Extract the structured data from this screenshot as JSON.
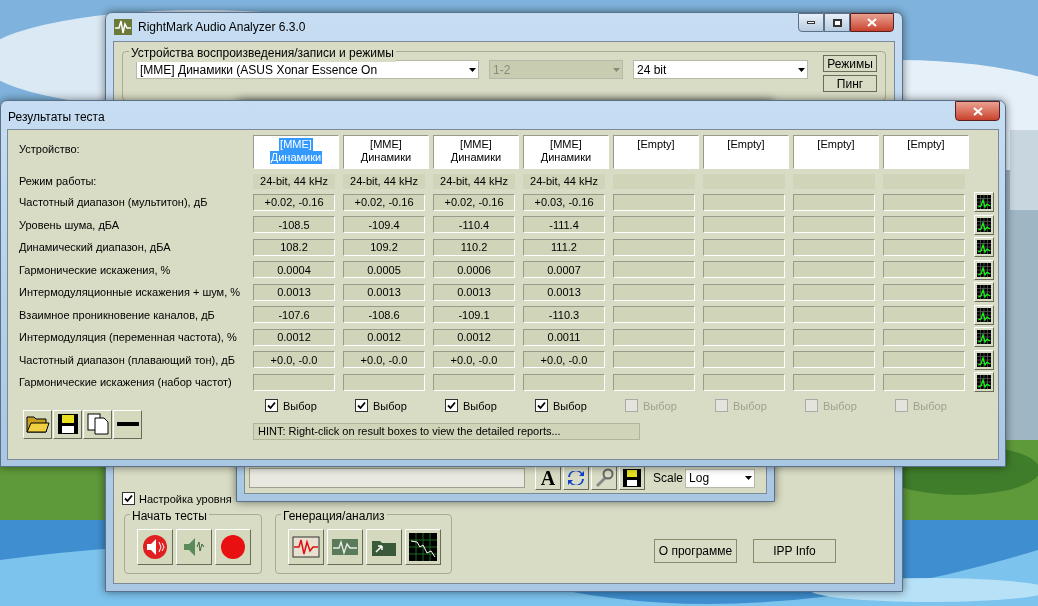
{
  "main_window": {
    "title": "RightMark Audio Analyzer 6.3.0",
    "devices_group": {
      "title": "Устройства воспроизведения/записи и режимы",
      "device": "[MME] Динамики (ASUS Xonar Essence On",
      "channels": "1-2",
      "channels_disabled": true,
      "format": "24 bit"
    },
    "side_buttons": [
      "Режимы",
      "Пинг"
    ],
    "level_checkbox": {
      "label": "Настройка уровня",
      "checked": true
    },
    "start_tests": {
      "title": "Начать тесты"
    },
    "generation": {
      "title": "Генерация/анализ"
    },
    "buttons": [
      "О программе",
      "IPP Info"
    ]
  },
  "phase_window": {
    "font_button": "A",
    "scale_label": "Scale",
    "scale_value": "Log"
  },
  "results_window": {
    "title": "Результаты теста",
    "device_label": "Устройство:",
    "mode_label": "Режим работы:",
    "columns": [
      {
        "device_lines": [
          "[MME]",
          "Динамики"
        ],
        "selected": true,
        "mode": "24-bit, 44 kHz",
        "pick": {
          "label": "Выбор",
          "checked": true,
          "enabled": true
        }
      },
      {
        "device_lines": [
          "[MME]",
          "Динамики"
        ],
        "selected": false,
        "mode": "24-bit, 44 kHz",
        "pick": {
          "label": "Выбор",
          "checked": true,
          "enabled": true
        }
      },
      {
        "device_lines": [
          "[MME]",
          "Динамики"
        ],
        "selected": false,
        "mode": "24-bit, 44 kHz",
        "pick": {
          "label": "Выбор",
          "checked": true,
          "enabled": true
        }
      },
      {
        "device_lines": [
          "[MME]",
          "Динамики"
        ],
        "selected": false,
        "mode": "24-bit, 44 kHz",
        "pick": {
          "label": "Выбор",
          "checked": true,
          "enabled": true
        }
      },
      {
        "device_lines": [
          "[Empty]"
        ],
        "selected": false,
        "pick": {
          "label": "Выбор",
          "checked": false,
          "enabled": false
        }
      },
      {
        "device_lines": [
          "[Empty]"
        ],
        "selected": false,
        "pick": {
          "label": "Выбор",
          "checked": false,
          "enabled": false
        }
      },
      {
        "device_lines": [
          "[Empty]"
        ],
        "selected": false,
        "pick": {
          "label": "Выбор",
          "checked": false,
          "enabled": false
        }
      },
      {
        "device_lines": [
          "[Empty]"
        ],
        "selected": false,
        "pick": {
          "label": "Выбор",
          "checked": false,
          "enabled": false
        }
      }
    ],
    "rows": [
      {
        "label": "Частотный диапазон (мультитон), дБ",
        "values": [
          "+0.02, -0.16",
          "+0.02, -0.16",
          "+0.02, -0.16",
          "+0.03, -0.16"
        ]
      },
      {
        "label": "Уровень шума, дБА",
        "values": [
          "-108.5",
          "-109.4",
          "-110.4",
          "-111.4"
        ]
      },
      {
        "label": "Динамический диапазон, дБА",
        "values": [
          "108.2",
          "109.2",
          "110.2",
          "111.2"
        ]
      },
      {
        "label": "Гармонические искажения, %",
        "values": [
          "0.0004",
          "0.0005",
          "0.0006",
          "0.0007"
        ]
      },
      {
        "label": "Интермодуляционные искажения + шум, %",
        "values": [
          "0.0013",
          "0.0013",
          "0.0013",
          "0.0013"
        ]
      },
      {
        "label": "Взаимное проникновение каналов, дБ",
        "values": [
          "-107.6",
          "-108.6",
          "-109.1",
          "-110.3"
        ]
      },
      {
        "label": "Интермодуляция (переменная частота), %",
        "values": [
          "0.0012",
          "0.0012",
          "0.0012",
          "0.0011"
        ]
      },
      {
        "label": "Частотный диапазон (плавающий тон), дБ",
        "values": [
          "+0.0, -0.0",
          "+0.0, -0.0",
          "+0.0, -0.0",
          "+0.0, -0.0"
        ]
      },
      {
        "label": "Гармонические искажения (набор частот)"
      }
    ],
    "hint": "HINT: Right-click on result boxes to view the detailed reports..."
  }
}
